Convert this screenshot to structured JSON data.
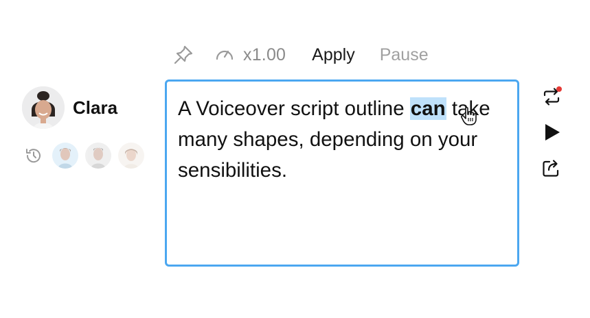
{
  "toolbar": {
    "pin_icon": "pin-icon",
    "speed_icon": "speedometer-icon",
    "speed_value": "x1.00",
    "apply_label": "Apply",
    "pause_label": "Pause"
  },
  "user": {
    "name": "Clara",
    "avatar_icon": "avatar"
  },
  "collaborators": {
    "history_icon": "history-icon",
    "avatars": [
      "collaborator-1",
      "collaborator-2",
      "collaborator-3"
    ]
  },
  "editor": {
    "text_before": "A Voiceover script outline ",
    "selected_word": "can",
    "text_after": " take many shapes, depending on your sensibilities.",
    "cursor_icon": "hand-cursor-icon"
  },
  "side_actions": {
    "icons": [
      "repeat-icon",
      "play-icon",
      "share-icon"
    ]
  },
  "colors": {
    "accent": "#4ba7f0",
    "selection": "#bfe1fb",
    "notification": "#e53935",
    "muted_text": "#8a8a8a",
    "disabled_text": "#a0a0a0"
  }
}
